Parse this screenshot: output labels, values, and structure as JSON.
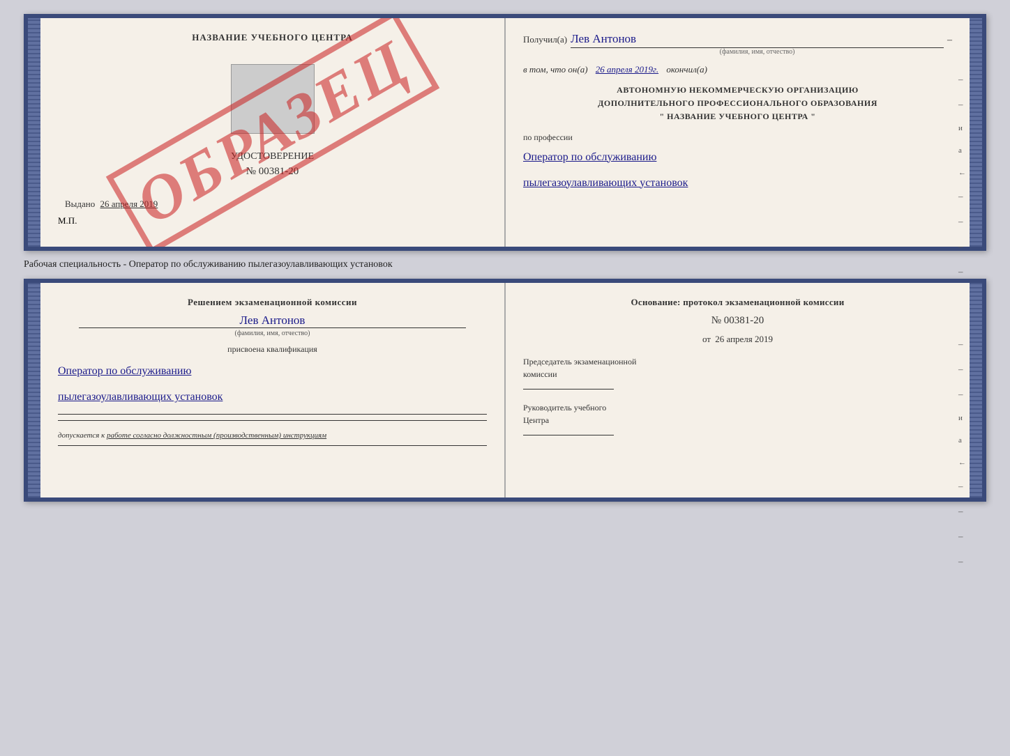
{
  "top_book": {
    "left": {
      "title": "НАЗВАНИЕ УЧЕБНОГО ЦЕНТРА",
      "cert_type": "УДОСТОВЕРЕНИЕ",
      "cert_number": "№ 00381-20",
      "issued_label": "Выдано",
      "issued_date": "26 апреля 2019",
      "mp_label": "М.П.",
      "watermark": "ОБРАЗЕЦ"
    },
    "right": {
      "received_label": "Получил(а)",
      "person_name": "Лев Антонов",
      "fio_sub": "(фамилия, имя, отчество)",
      "date_prefix": "в том, что он(а)",
      "date_value": "26 апреля 2019г.",
      "date_suffix": "окончил(а)",
      "org_line1": "АВТОНОМНУЮ НЕКОММЕРЧЕСКУЮ ОРГАНИЗАЦИЮ",
      "org_line2": "ДОПОЛНИТЕЛЬНОГО ПРОФЕССИОНАЛЬНОГО ОБРАЗОВАНИЯ",
      "org_line3": "\" НАЗВАНИЕ УЧЕБНОГО ЦЕНТРА \"",
      "profession_label": "по профессии",
      "profession_line1": "Оператор по обслуживанию",
      "profession_line2": "пылегазоулавливающих установок"
    }
  },
  "between_label": "Рабочая специальность - Оператор по обслуживанию пылегазоулавливающих установок",
  "bottom_book": {
    "left": {
      "decision_title": "Решением экзаменационной комиссии",
      "person_name": "Лев Антонов",
      "fio_sub": "(фамилия, имя, отчество)",
      "qualification_label": "присвоена квалификация",
      "qualification_line1": "Оператор по обслуживанию",
      "qualification_line2": "пылегазоулавливающих установок",
      "dopusk_prefix": "допускается к",
      "dopusk_text": "работе согласно должностным (производственным) инструкциям"
    },
    "right": {
      "osnov_title": "Основание: протокол экзаменационной комиссии",
      "protocol_number": "№ 00381-20",
      "date_prefix": "от",
      "date_value": "26 апреля 2019",
      "chairman_line1": "Председатель экзаменационной",
      "chairman_line2": "комиссии",
      "head_line1": "Руководитель учебного",
      "head_line2": "Центра"
    }
  }
}
